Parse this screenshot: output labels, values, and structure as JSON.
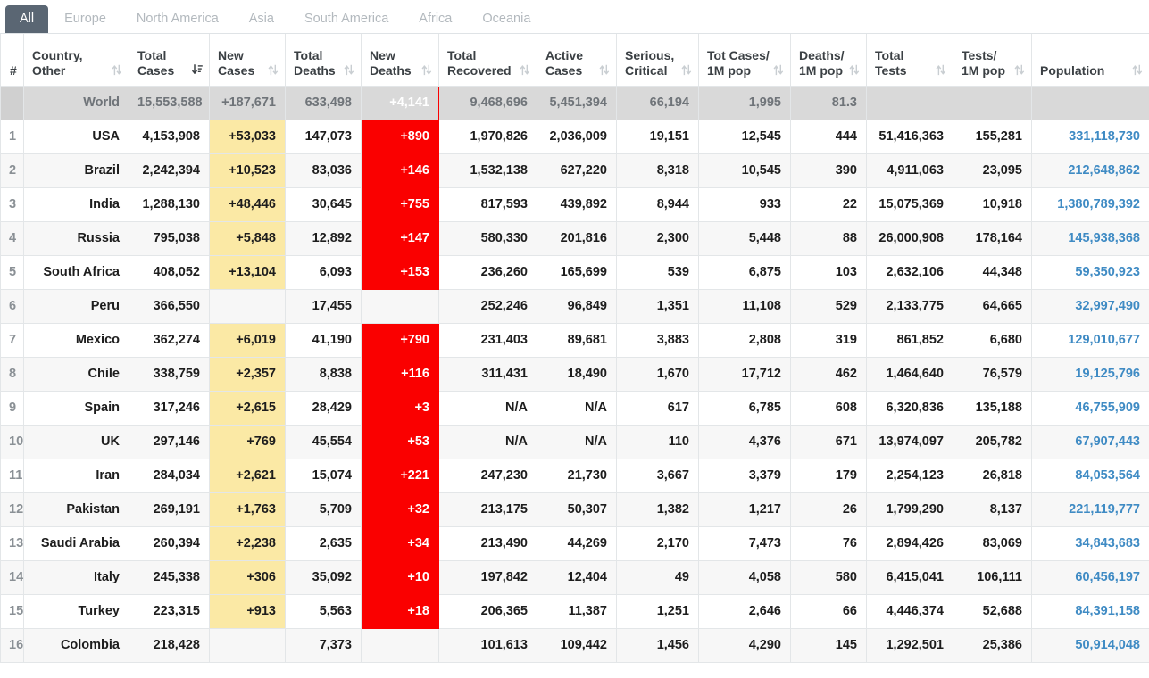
{
  "tabs": [
    {
      "label": "All",
      "active": true
    },
    {
      "label": "Europe",
      "active": false
    },
    {
      "label": "North America",
      "active": false
    },
    {
      "label": "Asia",
      "active": false
    },
    {
      "label": "South America",
      "active": false
    },
    {
      "label": "Africa",
      "active": false
    },
    {
      "label": "Oceania",
      "active": false
    }
  ],
  "colors": {
    "active_tab_bg": "#5a6673",
    "new_cases_highlight": "#fbe9a5",
    "new_deaths_highlight": "#fa0000",
    "country_link": "#2a6496",
    "population_link": "#3f8bc4",
    "world_row_bg": "#d9d9d9"
  },
  "table": {
    "columns": [
      {
        "key": "idx",
        "label": "#",
        "sort": "none"
      },
      {
        "key": "country",
        "label": "Country,\nOther",
        "sort": "both"
      },
      {
        "key": "total_cases",
        "label": "Total\nCases",
        "sort": "desc-active"
      },
      {
        "key": "new_cases",
        "label": "New\nCases",
        "sort": "both"
      },
      {
        "key": "total_deaths",
        "label": "Total\nDeaths",
        "sort": "both"
      },
      {
        "key": "new_deaths",
        "label": "New\nDeaths",
        "sort": "both"
      },
      {
        "key": "total_recovered",
        "label": "Total\nRecovered",
        "sort": "both"
      },
      {
        "key": "active_cases",
        "label": "Active\nCases",
        "sort": "both"
      },
      {
        "key": "serious_critical",
        "label": "Serious,\nCritical",
        "sort": "both"
      },
      {
        "key": "tot_cases_1m",
        "label": "Tot Cases/\n1M pop",
        "sort": "both"
      },
      {
        "key": "deaths_1m",
        "label": "Deaths/\n1M pop",
        "sort": "both"
      },
      {
        "key": "total_tests",
        "label": "Total\nTests",
        "sort": "both"
      },
      {
        "key": "tests_1m",
        "label": "Tests/\n1M pop",
        "sort": "both"
      },
      {
        "key": "population",
        "label": "Population",
        "sort": "both"
      }
    ],
    "world": {
      "idx": "",
      "country": "World",
      "total_cases": "15,553,588",
      "new_cases": "+187,671",
      "total_deaths": "633,498",
      "new_deaths": "+4,141",
      "total_recovered": "9,468,696",
      "active_cases": "5,451,394",
      "serious_critical": "66,194",
      "tot_cases_1m": "1,995",
      "deaths_1m": "81.3",
      "total_tests": "",
      "tests_1m": "",
      "population": ""
    },
    "rows": [
      {
        "idx": "1",
        "country": "USA",
        "total_cases": "4,153,908",
        "new_cases": "+53,033",
        "total_deaths": "147,073",
        "new_deaths": "+890",
        "total_recovered": "1,970,826",
        "active_cases": "2,036,009",
        "serious_critical": "19,151",
        "tot_cases_1m": "12,545",
        "deaths_1m": "444",
        "total_tests": "51,416,363",
        "tests_1m": "155,281",
        "population": "331,118,730"
      },
      {
        "idx": "2",
        "country": "Brazil",
        "total_cases": "2,242,394",
        "new_cases": "+10,523",
        "total_deaths": "83,036",
        "new_deaths": "+146",
        "total_recovered": "1,532,138",
        "active_cases": "627,220",
        "serious_critical": "8,318",
        "tot_cases_1m": "10,545",
        "deaths_1m": "390",
        "total_tests": "4,911,063",
        "tests_1m": "23,095",
        "population": "212,648,862"
      },
      {
        "idx": "3",
        "country": "India",
        "total_cases": "1,288,130",
        "new_cases": "+48,446",
        "total_deaths": "30,645",
        "new_deaths": "+755",
        "total_recovered": "817,593",
        "active_cases": "439,892",
        "serious_critical": "8,944",
        "tot_cases_1m": "933",
        "deaths_1m": "22",
        "total_tests": "15,075,369",
        "tests_1m": "10,918",
        "population": "1,380,789,392"
      },
      {
        "idx": "4",
        "country": "Russia",
        "total_cases": "795,038",
        "new_cases": "+5,848",
        "total_deaths": "12,892",
        "new_deaths": "+147",
        "total_recovered": "580,330",
        "active_cases": "201,816",
        "serious_critical": "2,300",
        "tot_cases_1m": "5,448",
        "deaths_1m": "88",
        "total_tests": "26,000,908",
        "tests_1m": "178,164",
        "population": "145,938,368"
      },
      {
        "idx": "5",
        "country": "South Africa",
        "total_cases": "408,052",
        "new_cases": "+13,104",
        "total_deaths": "6,093",
        "new_deaths": "+153",
        "total_recovered": "236,260",
        "active_cases": "165,699",
        "serious_critical": "539",
        "tot_cases_1m": "6,875",
        "deaths_1m": "103",
        "total_tests": "2,632,106",
        "tests_1m": "44,348",
        "population": "59,350,923"
      },
      {
        "idx": "6",
        "country": "Peru",
        "total_cases": "366,550",
        "new_cases": "",
        "total_deaths": "17,455",
        "new_deaths": "",
        "total_recovered": "252,246",
        "active_cases": "96,849",
        "serious_critical": "1,351",
        "tot_cases_1m": "11,108",
        "deaths_1m": "529",
        "total_tests": "2,133,775",
        "tests_1m": "64,665",
        "population": "32,997,490"
      },
      {
        "idx": "7",
        "country": "Mexico",
        "total_cases": "362,274",
        "new_cases": "+6,019",
        "total_deaths": "41,190",
        "new_deaths": "+790",
        "total_recovered": "231,403",
        "active_cases": "89,681",
        "serious_critical": "3,883",
        "tot_cases_1m": "2,808",
        "deaths_1m": "319",
        "total_tests": "861,852",
        "tests_1m": "6,680",
        "population": "129,010,677"
      },
      {
        "idx": "8",
        "country": "Chile",
        "total_cases": "338,759",
        "new_cases": "+2,357",
        "total_deaths": "8,838",
        "new_deaths": "+116",
        "total_recovered": "311,431",
        "active_cases": "18,490",
        "serious_critical": "1,670",
        "tot_cases_1m": "17,712",
        "deaths_1m": "462",
        "total_tests": "1,464,640",
        "tests_1m": "76,579",
        "population": "19,125,796"
      },
      {
        "idx": "9",
        "country": "Spain",
        "total_cases": "317,246",
        "new_cases": "+2,615",
        "total_deaths": "28,429",
        "new_deaths": "+3",
        "total_recovered": "N/A",
        "active_cases": "N/A",
        "serious_critical": "617",
        "tot_cases_1m": "6,785",
        "deaths_1m": "608",
        "total_tests": "6,320,836",
        "tests_1m": "135,188",
        "population": "46,755,909"
      },
      {
        "idx": "10",
        "country": "UK",
        "total_cases": "297,146",
        "new_cases": "+769",
        "total_deaths": "45,554",
        "new_deaths": "+53",
        "total_recovered": "N/A",
        "active_cases": "N/A",
        "serious_critical": "110",
        "tot_cases_1m": "4,376",
        "deaths_1m": "671",
        "total_tests": "13,974,097",
        "tests_1m": "205,782",
        "population": "67,907,443"
      },
      {
        "idx": "11",
        "country": "Iran",
        "total_cases": "284,034",
        "new_cases": "+2,621",
        "total_deaths": "15,074",
        "new_deaths": "+221",
        "total_recovered": "247,230",
        "active_cases": "21,730",
        "serious_critical": "3,667",
        "tot_cases_1m": "3,379",
        "deaths_1m": "179",
        "total_tests": "2,254,123",
        "tests_1m": "26,818",
        "population": "84,053,564"
      },
      {
        "idx": "12",
        "country": "Pakistan",
        "total_cases": "269,191",
        "new_cases": "+1,763",
        "total_deaths": "5,709",
        "new_deaths": "+32",
        "total_recovered": "213,175",
        "active_cases": "50,307",
        "serious_critical": "1,382",
        "tot_cases_1m": "1,217",
        "deaths_1m": "26",
        "total_tests": "1,799,290",
        "tests_1m": "8,137",
        "population": "221,119,777"
      },
      {
        "idx": "13",
        "country": "Saudi Arabia",
        "total_cases": "260,394",
        "new_cases": "+2,238",
        "total_deaths": "2,635",
        "new_deaths": "+34",
        "total_recovered": "213,490",
        "active_cases": "44,269",
        "serious_critical": "2,170",
        "tot_cases_1m": "7,473",
        "deaths_1m": "76",
        "total_tests": "2,894,426",
        "tests_1m": "83,069",
        "population": "34,843,683"
      },
      {
        "idx": "14",
        "country": "Italy",
        "total_cases": "245,338",
        "new_cases": "+306",
        "total_deaths": "35,092",
        "new_deaths": "+10",
        "total_recovered": "197,842",
        "active_cases": "12,404",
        "serious_critical": "49",
        "tot_cases_1m": "4,058",
        "deaths_1m": "580",
        "total_tests": "6,415,041",
        "tests_1m": "106,111",
        "population": "60,456,197"
      },
      {
        "idx": "15",
        "country": "Turkey",
        "total_cases": "223,315",
        "new_cases": "+913",
        "total_deaths": "5,563",
        "new_deaths": "+18",
        "total_recovered": "206,365",
        "active_cases": "11,387",
        "serious_critical": "1,251",
        "tot_cases_1m": "2,646",
        "deaths_1m": "66",
        "total_tests": "4,446,374",
        "tests_1m": "52,688",
        "population": "84,391,158"
      },
      {
        "idx": "16",
        "country": "Colombia",
        "total_cases": "218,428",
        "new_cases": "",
        "total_deaths": "7,373",
        "new_deaths": "",
        "total_recovered": "101,613",
        "active_cases": "109,442",
        "serious_critical": "1,456",
        "tot_cases_1m": "4,290",
        "deaths_1m": "145",
        "total_tests": "1,292,501",
        "tests_1m": "25,386",
        "population": "50,914,048"
      }
    ]
  }
}
